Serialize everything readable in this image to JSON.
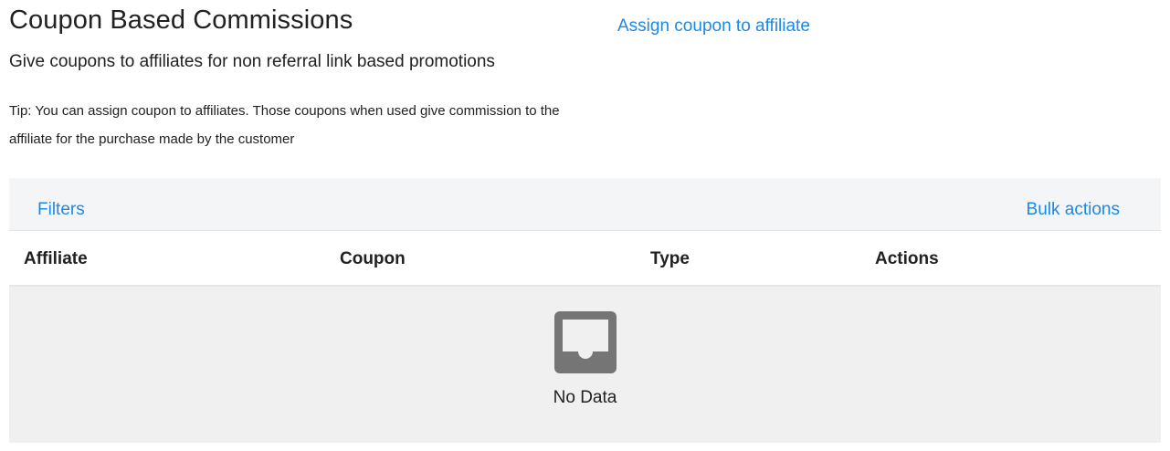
{
  "header": {
    "title": "Coupon Based Commissions",
    "assign_link": "Assign coupon to affiliate",
    "subtitle": "Give coupons to affiliates for non referral link based promotions",
    "tip": "Tip: You can assign coupon to affiliates. Those coupons when used give commission to the affiliate for the purchase made by the customer"
  },
  "toolbar": {
    "filters": "Filters",
    "bulk_actions": "Bulk actions"
  },
  "table": {
    "columns": [
      "Affiliate",
      "Coupon",
      "Type",
      "Actions"
    ],
    "rows": [],
    "empty_text": "No Data",
    "empty_icon": "inbox-icon"
  },
  "colors": {
    "link": "#1e88e5",
    "toolbar_bg": "#f4f5f7",
    "empty_bg": "#f0f0f0",
    "icon": "#757575"
  }
}
